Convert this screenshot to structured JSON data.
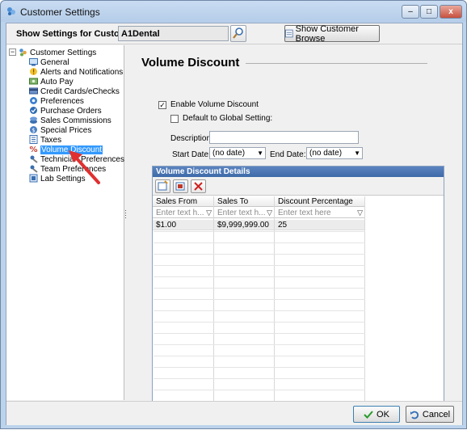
{
  "window": {
    "title": "Customer Settings",
    "minimize": "–",
    "maximize": "□",
    "close": "x"
  },
  "topbar": {
    "label": "Show Settings for Customer:",
    "customer_value": "A1Dental",
    "browse_label": "Show Customer Browse"
  },
  "tree": {
    "root": "Customer Settings",
    "items": [
      {
        "label": "General",
        "icon": "monitor-icon"
      },
      {
        "label": "Alerts and Notifications",
        "icon": "alert-icon"
      },
      {
        "label": "Auto Pay",
        "icon": "autopay-icon"
      },
      {
        "label": "Credit Cards/eChecks",
        "icon": "credit-card-icon"
      },
      {
        "label": "Preferences",
        "icon": "preferences-icon"
      },
      {
        "label": "Purchase Orders",
        "icon": "purchase-order-icon"
      },
      {
        "label": "Sales Commissions",
        "icon": "commission-icon"
      },
      {
        "label": "Special Prices",
        "icon": "price-icon"
      },
      {
        "label": "Taxes",
        "icon": "tax-icon"
      },
      {
        "label": "Volume Discount",
        "icon": "percent-icon"
      },
      {
        "label": "Technician Preferences",
        "icon": "technician-icon"
      },
      {
        "label": "Team Preferences",
        "icon": "team-icon"
      },
      {
        "label": "Lab Settings",
        "icon": "lab-icon"
      }
    ]
  },
  "main": {
    "heading": "Volume Discount",
    "enable_label": "Enable Volume Discount",
    "enable_checked": true,
    "default_label": "Default to Global Setting:",
    "default_checked": false,
    "description_label": "Description:",
    "description_value": "",
    "start_date_label": "Start Date:",
    "start_date_value": "(no date)",
    "end_date_label": "End Date:",
    "end_date_value": "(no date)"
  },
  "grid": {
    "title": "Volume Discount Details",
    "columns": [
      "Sales From",
      "Sales To",
      "Discount Percentage"
    ],
    "filter_placeholders": [
      "Enter text h...",
      "Enter text h...",
      "Enter text here"
    ],
    "rows": [
      [
        "$1.00",
        "$9,999,999.00",
        "25"
      ]
    ]
  },
  "buttons": {
    "ok": "OK",
    "cancel": "Cancel"
  },
  "colors": {
    "selection": "#3399ff",
    "grid_header": "#3e6aa9",
    "annotation_arrow": "#e03030"
  }
}
